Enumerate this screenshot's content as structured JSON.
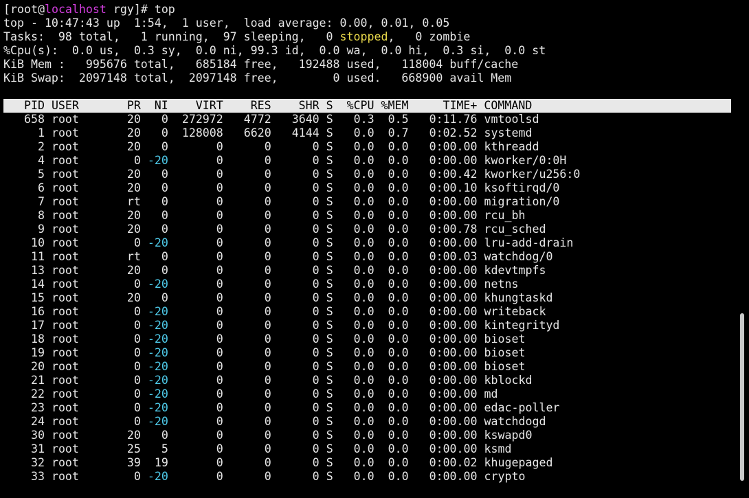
{
  "prompt": {
    "open_bracket": "[",
    "user": "root",
    "at": "@",
    "host": "localhost",
    "dir": " rgy]# ",
    "command": "top"
  },
  "summary": {
    "uptime_line": "top - 10:47:43 up  1:54,  1 user,  load average: 0.00, 0.01, 0.05",
    "tasks_prefix": "Tasks:  98 total,   1 running,  97 sleeping,   0 ",
    "tasks_stopped_word": "stopped",
    "tasks_suffix": ",   0 zombie",
    "cpu_line": "%Cpu(s):  0.0 us,  0.3 sy,  0.0 ni, 99.3 id,  0.0 wa,  0.0 hi,  0.3 si,  0.0 st",
    "mem_line": "KiB Mem :   995676 total,   685184 free,   192488 used,   118004 buff/cache",
    "swap_line": "KiB Swap:  2097148 total,  2097148 free,        0 used.   668900 avail Mem"
  },
  "columns": [
    "PID",
    "USER",
    "PR",
    "NI",
    "VIRT",
    "RES",
    "SHR",
    "S",
    "%CPU",
    "%MEM",
    "TIME+",
    "COMMAND"
  ],
  "processes": [
    {
      "pid": "658",
      "user": "root",
      "pr": "20",
      "ni": "0",
      "virt": "272972",
      "res": "4772",
      "shr": "3640",
      "s": "S",
      "cpu": "0.3",
      "mem": "0.5",
      "time": "0:11.76",
      "command": "vmtoolsd"
    },
    {
      "pid": "1",
      "user": "root",
      "pr": "20",
      "ni": "0",
      "virt": "128008",
      "res": "6620",
      "shr": "4144",
      "s": "S",
      "cpu": "0.0",
      "mem": "0.7",
      "time": "0:02.52",
      "command": "systemd"
    },
    {
      "pid": "2",
      "user": "root",
      "pr": "20",
      "ni": "0",
      "virt": "0",
      "res": "0",
      "shr": "0",
      "s": "S",
      "cpu": "0.0",
      "mem": "0.0",
      "time": "0:00.00",
      "command": "kthreadd"
    },
    {
      "pid": "4",
      "user": "root",
      "pr": "0",
      "ni": "-20",
      "virt": "0",
      "res": "0",
      "shr": "0",
      "s": "S",
      "cpu": "0.0",
      "mem": "0.0",
      "time": "0:00.00",
      "command": "kworker/0:0H"
    },
    {
      "pid": "5",
      "user": "root",
      "pr": "20",
      "ni": "0",
      "virt": "0",
      "res": "0",
      "shr": "0",
      "s": "S",
      "cpu": "0.0",
      "mem": "0.0",
      "time": "0:00.42",
      "command": "kworker/u256:0"
    },
    {
      "pid": "6",
      "user": "root",
      "pr": "20",
      "ni": "0",
      "virt": "0",
      "res": "0",
      "shr": "0",
      "s": "S",
      "cpu": "0.0",
      "mem": "0.0",
      "time": "0:00.10",
      "command": "ksoftirqd/0"
    },
    {
      "pid": "7",
      "user": "root",
      "pr": "rt",
      "ni": "0",
      "virt": "0",
      "res": "0",
      "shr": "0",
      "s": "S",
      "cpu": "0.0",
      "mem": "0.0",
      "time": "0:00.00",
      "command": "migration/0"
    },
    {
      "pid": "8",
      "user": "root",
      "pr": "20",
      "ni": "0",
      "virt": "0",
      "res": "0",
      "shr": "0",
      "s": "S",
      "cpu": "0.0",
      "mem": "0.0",
      "time": "0:00.00",
      "command": "rcu_bh"
    },
    {
      "pid": "9",
      "user": "root",
      "pr": "20",
      "ni": "0",
      "virt": "0",
      "res": "0",
      "shr": "0",
      "s": "S",
      "cpu": "0.0",
      "mem": "0.0",
      "time": "0:00.78",
      "command": "rcu_sched"
    },
    {
      "pid": "10",
      "user": "root",
      "pr": "0",
      "ni": "-20",
      "virt": "0",
      "res": "0",
      "shr": "0",
      "s": "S",
      "cpu": "0.0",
      "mem": "0.0",
      "time": "0:00.00",
      "command": "lru-add-drain"
    },
    {
      "pid": "11",
      "user": "root",
      "pr": "rt",
      "ni": "0",
      "virt": "0",
      "res": "0",
      "shr": "0",
      "s": "S",
      "cpu": "0.0",
      "mem": "0.0",
      "time": "0:00.03",
      "command": "watchdog/0"
    },
    {
      "pid": "13",
      "user": "root",
      "pr": "20",
      "ni": "0",
      "virt": "0",
      "res": "0",
      "shr": "0",
      "s": "S",
      "cpu": "0.0",
      "mem": "0.0",
      "time": "0:00.00",
      "command": "kdevtmpfs"
    },
    {
      "pid": "14",
      "user": "root",
      "pr": "0",
      "ni": "-20",
      "virt": "0",
      "res": "0",
      "shr": "0",
      "s": "S",
      "cpu": "0.0",
      "mem": "0.0",
      "time": "0:00.00",
      "command": "netns"
    },
    {
      "pid": "15",
      "user": "root",
      "pr": "20",
      "ni": "0",
      "virt": "0",
      "res": "0",
      "shr": "0",
      "s": "S",
      "cpu": "0.0",
      "mem": "0.0",
      "time": "0:00.00",
      "command": "khungtaskd"
    },
    {
      "pid": "16",
      "user": "root",
      "pr": "0",
      "ni": "-20",
      "virt": "0",
      "res": "0",
      "shr": "0",
      "s": "S",
      "cpu": "0.0",
      "mem": "0.0",
      "time": "0:00.00",
      "command": "writeback"
    },
    {
      "pid": "17",
      "user": "root",
      "pr": "0",
      "ni": "-20",
      "virt": "0",
      "res": "0",
      "shr": "0",
      "s": "S",
      "cpu": "0.0",
      "mem": "0.0",
      "time": "0:00.00",
      "command": "kintegrityd"
    },
    {
      "pid": "18",
      "user": "root",
      "pr": "0",
      "ni": "-20",
      "virt": "0",
      "res": "0",
      "shr": "0",
      "s": "S",
      "cpu": "0.0",
      "mem": "0.0",
      "time": "0:00.00",
      "command": "bioset"
    },
    {
      "pid": "19",
      "user": "root",
      "pr": "0",
      "ni": "-20",
      "virt": "0",
      "res": "0",
      "shr": "0",
      "s": "S",
      "cpu": "0.0",
      "mem": "0.0",
      "time": "0:00.00",
      "command": "bioset"
    },
    {
      "pid": "20",
      "user": "root",
      "pr": "0",
      "ni": "-20",
      "virt": "0",
      "res": "0",
      "shr": "0",
      "s": "S",
      "cpu": "0.0",
      "mem": "0.0",
      "time": "0:00.00",
      "command": "bioset"
    },
    {
      "pid": "21",
      "user": "root",
      "pr": "0",
      "ni": "-20",
      "virt": "0",
      "res": "0",
      "shr": "0",
      "s": "S",
      "cpu": "0.0",
      "mem": "0.0",
      "time": "0:00.00",
      "command": "kblockd"
    },
    {
      "pid": "22",
      "user": "root",
      "pr": "0",
      "ni": "-20",
      "virt": "0",
      "res": "0",
      "shr": "0",
      "s": "S",
      "cpu": "0.0",
      "mem": "0.0",
      "time": "0:00.00",
      "command": "md"
    },
    {
      "pid": "23",
      "user": "root",
      "pr": "0",
      "ni": "-20",
      "virt": "0",
      "res": "0",
      "shr": "0",
      "s": "S",
      "cpu": "0.0",
      "mem": "0.0",
      "time": "0:00.00",
      "command": "edac-poller"
    },
    {
      "pid": "24",
      "user": "root",
      "pr": "0",
      "ni": "-20",
      "virt": "0",
      "res": "0",
      "shr": "0",
      "s": "S",
      "cpu": "0.0",
      "mem": "0.0",
      "time": "0:00.00",
      "command": "watchdogd"
    },
    {
      "pid": "30",
      "user": "root",
      "pr": "20",
      "ni": "0",
      "virt": "0",
      "res": "0",
      "shr": "0",
      "s": "S",
      "cpu": "0.0",
      "mem": "0.0",
      "time": "0:00.00",
      "command": "kswapd0"
    },
    {
      "pid": "31",
      "user": "root",
      "pr": "25",
      "ni": "5",
      "virt": "0",
      "res": "0",
      "shr": "0",
      "s": "S",
      "cpu": "0.0",
      "mem": "0.0",
      "time": "0:00.00",
      "command": "ksmd"
    },
    {
      "pid": "32",
      "user": "root",
      "pr": "39",
      "ni": "19",
      "virt": "0",
      "res": "0",
      "shr": "0",
      "s": "S",
      "cpu": "0.0",
      "mem": "0.0",
      "time": "0:00.02",
      "command": "khugepaged"
    },
    {
      "pid": "33",
      "user": "root",
      "pr": "0",
      "ni": "-20",
      "virt": "0",
      "res": "0",
      "shr": "0",
      "s": "S",
      "cpu": "0.0",
      "mem": "0.0",
      "time": "0:00.00",
      "command": "crypto"
    }
  ],
  "colors": {
    "background": "#000000",
    "foreground": "#e6e6e6",
    "header_bg": "#e8e8e8",
    "header_fg": "#000000",
    "hostname": "#d43ee0",
    "stopped": "#e8d84a",
    "negative_nice": "#4ec9e8"
  }
}
